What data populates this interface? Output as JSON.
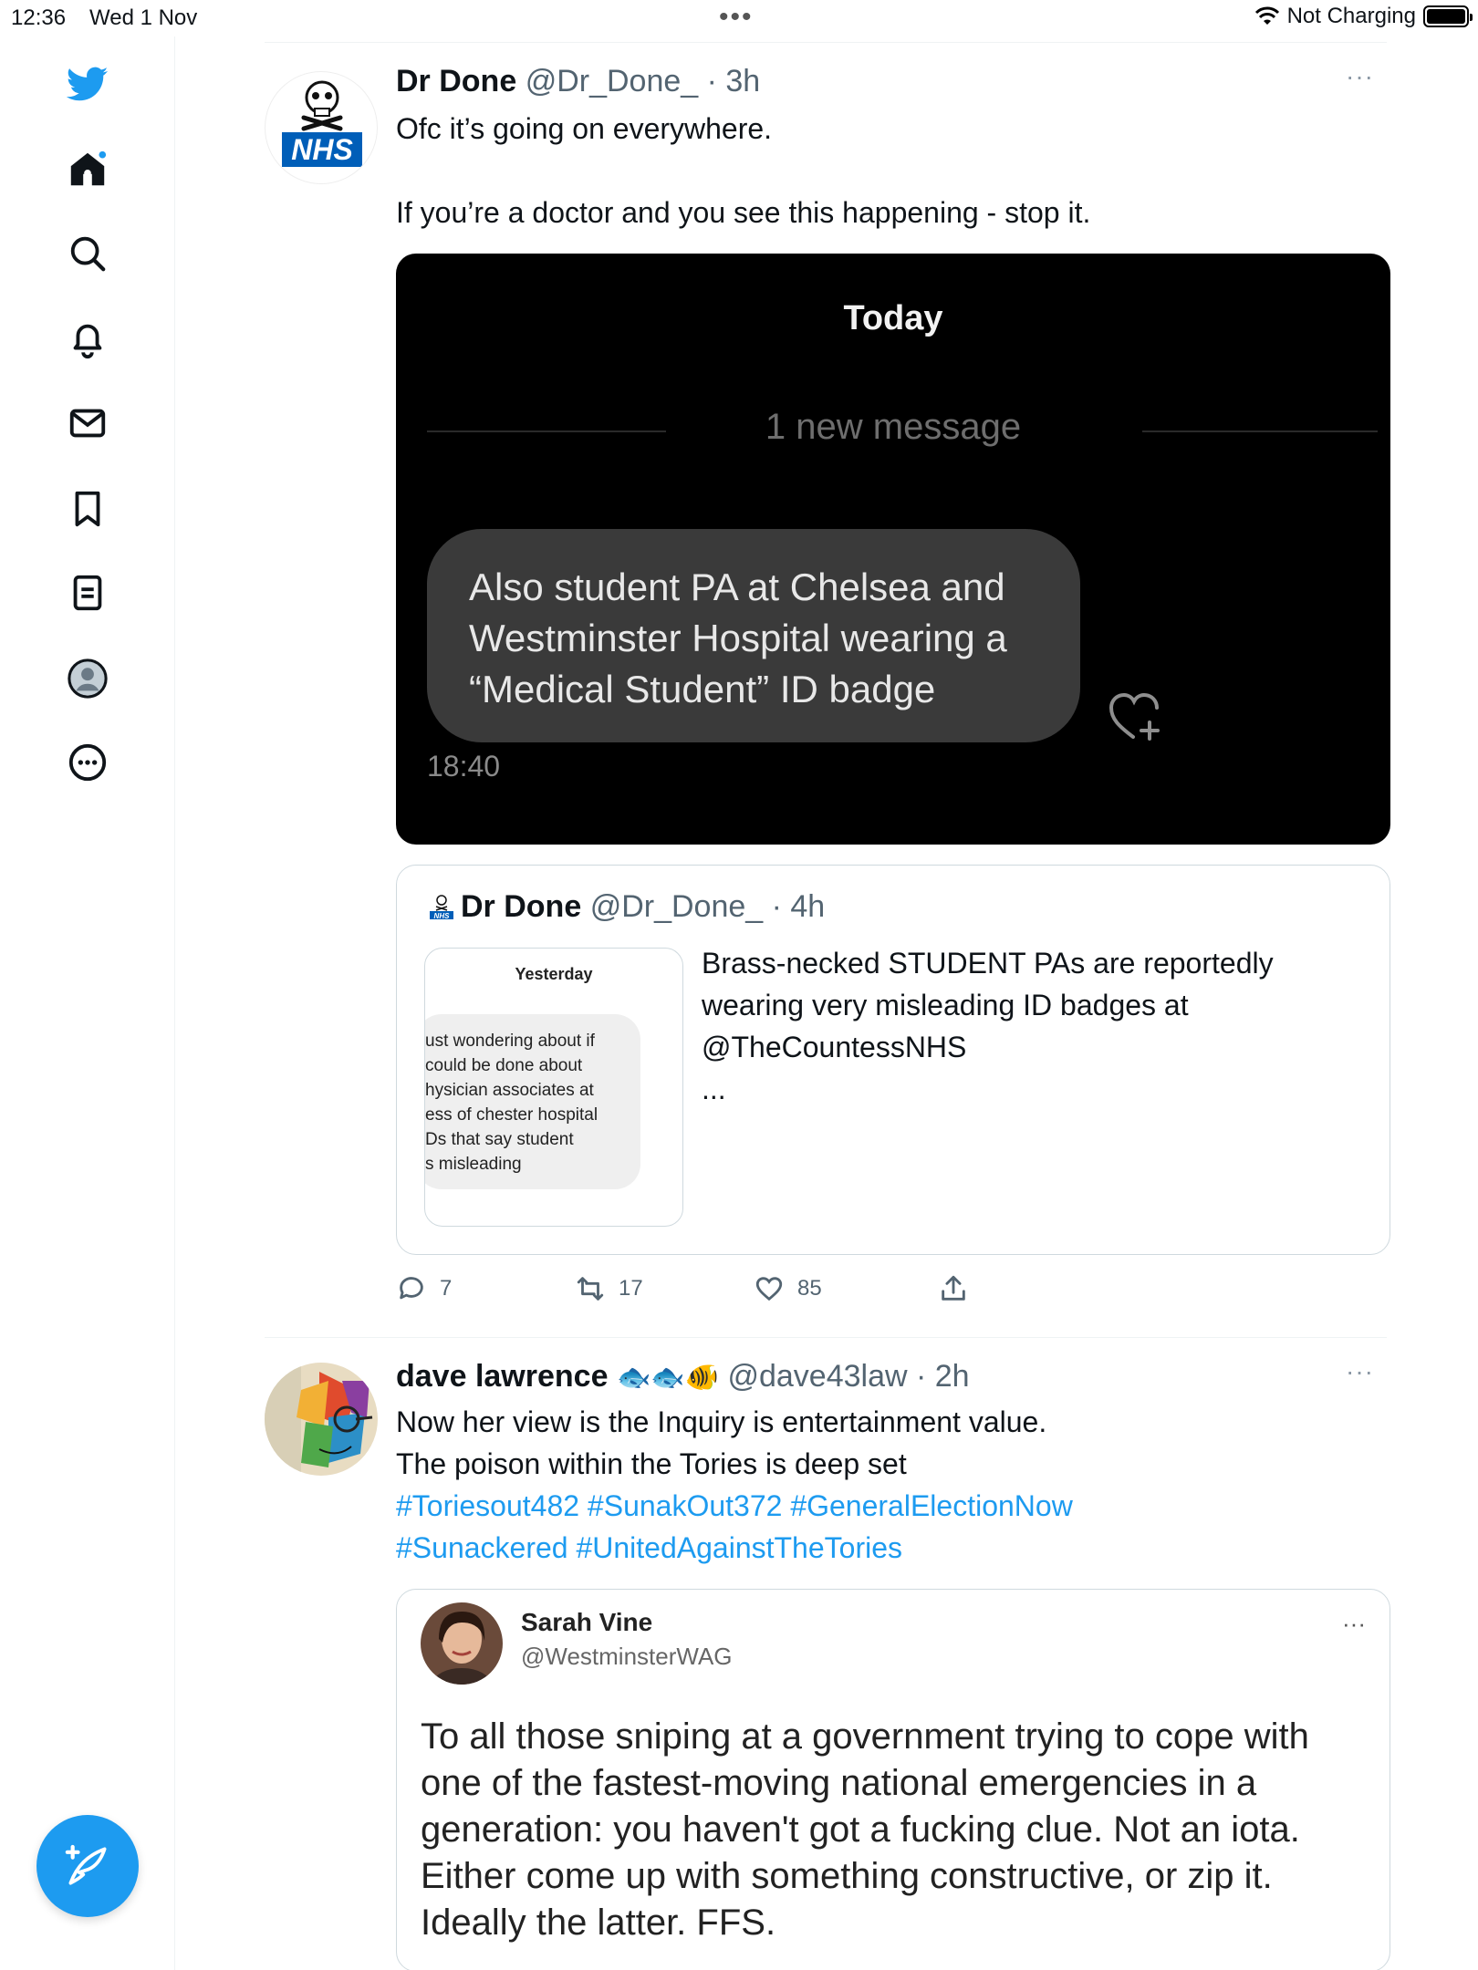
{
  "status_bar": {
    "time": "12:36",
    "date": "Wed 1 Nov",
    "center_dots": "•••",
    "charging": "Not Charging"
  },
  "sidebar": {
    "items": [
      {
        "icon": "twitter-logo-icon",
        "label": "Twitter"
      },
      {
        "icon": "home-icon",
        "label": "Home"
      },
      {
        "icon": "search-icon",
        "label": "Explore"
      },
      {
        "icon": "bell-icon",
        "label": "Notifications"
      },
      {
        "icon": "mail-icon",
        "label": "Messages"
      },
      {
        "icon": "bookmark-icon",
        "label": "Bookmarks"
      },
      {
        "icon": "lists-icon",
        "label": "Lists"
      },
      {
        "icon": "profile-icon",
        "label": "Profile"
      },
      {
        "icon": "more-icon",
        "label": "More"
      }
    ],
    "compose_icon": "compose-tweet-icon"
  },
  "tweets": [
    {
      "name": "Dr Done",
      "meta": "@Dr_Done_ · 3h",
      "avatar_text": "NHS",
      "text_line1": "Ofc it’s going on everywhere.",
      "text_line2": "If you’re a doctor and you see this happening - stop it.",
      "more": "···",
      "media": {
        "header": "Today",
        "new_message": "1 new message",
        "bubble": "Also student PA at Chelsea and Westminster Hospital wearing a “Medical Student” ID badge",
        "time": "18:40"
      },
      "quoted": {
        "name": "Dr Done",
        "meta": "@Dr_Done_ · 4h",
        "avatar_text": "NHS",
        "thumb_header": "Yesterday",
        "thumb_lines": [
          "ust wondering about if",
          "could be done about",
          "hysician associates at",
          "ess of chester hospital",
          "Ds that say student",
          "s misleading"
        ],
        "text": "Brass-necked STUDENT PAs are reportedly wearing very misleading ID badges at @TheCountessNHS",
        "ellipsis": "..."
      },
      "actions": {
        "replies": "7",
        "retweets": "17",
        "likes": "85"
      }
    },
    {
      "name": "dave lawrence",
      "emojis": "🐟🐟🐠",
      "meta": "@dave43law · 2h",
      "more": "···",
      "text_line1": "Now her view is the Inquiry is entertainment value.",
      "text_line2": "The poison within the Tories is deep set",
      "hashtags_line1": "#Toriesout482 #SunakOut372 #GeneralElectionNow",
      "hashtags_line2": "#Sunackered #UnitedAgainstTheTories",
      "quoted": {
        "name": "Sarah Vine",
        "handle": "@WestminsterWAG",
        "more": "···",
        "text": "To all those sniping at a government trying to cope with one of the fastest-moving national emergencies in a generation: you haven't got a fucking clue. Not an iota. Either come up with something constructive, or zip it. Ideally the latter. FFS."
      }
    }
  ],
  "colors": {
    "accent": "#1d9bf0",
    "text": "#0f1419",
    "muted": "#536471",
    "border": "#cfd9de"
  }
}
